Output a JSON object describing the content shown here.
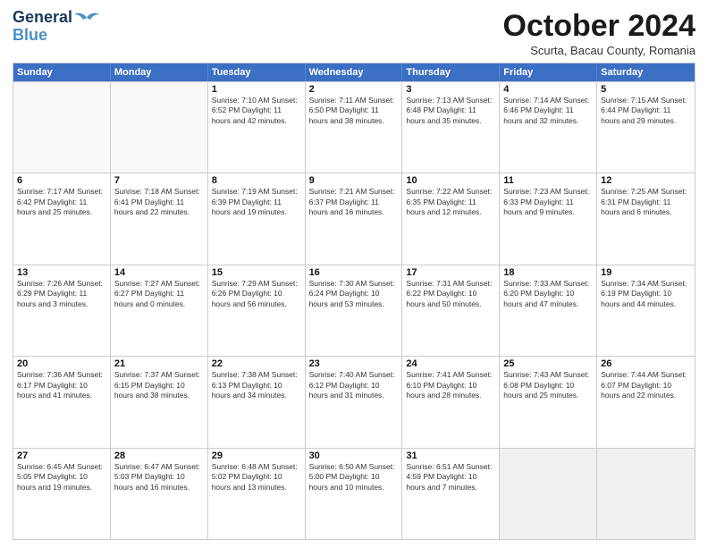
{
  "header": {
    "logo_line1": "General",
    "logo_line2": "Blue",
    "month_title": "October 2024",
    "location": "Scurta, Bacau County, Romania"
  },
  "days_of_week": [
    "Sunday",
    "Monday",
    "Tuesday",
    "Wednesday",
    "Thursday",
    "Friday",
    "Saturday"
  ],
  "weeks": [
    [
      {
        "day": "",
        "info": "",
        "empty": true
      },
      {
        "day": "",
        "info": "",
        "empty": true
      },
      {
        "day": "1",
        "info": "Sunrise: 7:10 AM\nSunset: 6:52 PM\nDaylight: 11 hours and 42 minutes."
      },
      {
        "day": "2",
        "info": "Sunrise: 7:11 AM\nSunset: 6:50 PM\nDaylight: 11 hours and 38 minutes."
      },
      {
        "day": "3",
        "info": "Sunrise: 7:13 AM\nSunset: 6:48 PM\nDaylight: 11 hours and 35 minutes."
      },
      {
        "day": "4",
        "info": "Sunrise: 7:14 AM\nSunset: 6:46 PM\nDaylight: 11 hours and 32 minutes."
      },
      {
        "day": "5",
        "info": "Sunrise: 7:15 AM\nSunset: 6:44 PM\nDaylight: 11 hours and 29 minutes."
      }
    ],
    [
      {
        "day": "6",
        "info": "Sunrise: 7:17 AM\nSunset: 6:42 PM\nDaylight: 11 hours and 25 minutes."
      },
      {
        "day": "7",
        "info": "Sunrise: 7:18 AM\nSunset: 6:41 PM\nDaylight: 11 hours and 22 minutes."
      },
      {
        "day": "8",
        "info": "Sunrise: 7:19 AM\nSunset: 6:39 PM\nDaylight: 11 hours and 19 minutes."
      },
      {
        "day": "9",
        "info": "Sunrise: 7:21 AM\nSunset: 6:37 PM\nDaylight: 11 hours and 16 minutes."
      },
      {
        "day": "10",
        "info": "Sunrise: 7:22 AM\nSunset: 6:35 PM\nDaylight: 11 hours and 12 minutes."
      },
      {
        "day": "11",
        "info": "Sunrise: 7:23 AM\nSunset: 6:33 PM\nDaylight: 11 hours and 9 minutes."
      },
      {
        "day": "12",
        "info": "Sunrise: 7:25 AM\nSunset: 6:31 PM\nDaylight: 11 hours and 6 minutes."
      }
    ],
    [
      {
        "day": "13",
        "info": "Sunrise: 7:26 AM\nSunset: 6:29 PM\nDaylight: 11 hours and 3 minutes."
      },
      {
        "day": "14",
        "info": "Sunrise: 7:27 AM\nSunset: 6:27 PM\nDaylight: 11 hours and 0 minutes."
      },
      {
        "day": "15",
        "info": "Sunrise: 7:29 AM\nSunset: 6:26 PM\nDaylight: 10 hours and 56 minutes."
      },
      {
        "day": "16",
        "info": "Sunrise: 7:30 AM\nSunset: 6:24 PM\nDaylight: 10 hours and 53 minutes."
      },
      {
        "day": "17",
        "info": "Sunrise: 7:31 AM\nSunset: 6:22 PM\nDaylight: 10 hours and 50 minutes."
      },
      {
        "day": "18",
        "info": "Sunrise: 7:33 AM\nSunset: 6:20 PM\nDaylight: 10 hours and 47 minutes."
      },
      {
        "day": "19",
        "info": "Sunrise: 7:34 AM\nSunset: 6:19 PM\nDaylight: 10 hours and 44 minutes."
      }
    ],
    [
      {
        "day": "20",
        "info": "Sunrise: 7:36 AM\nSunset: 6:17 PM\nDaylight: 10 hours and 41 minutes."
      },
      {
        "day": "21",
        "info": "Sunrise: 7:37 AM\nSunset: 6:15 PM\nDaylight: 10 hours and 38 minutes."
      },
      {
        "day": "22",
        "info": "Sunrise: 7:38 AM\nSunset: 6:13 PM\nDaylight: 10 hours and 34 minutes."
      },
      {
        "day": "23",
        "info": "Sunrise: 7:40 AM\nSunset: 6:12 PM\nDaylight: 10 hours and 31 minutes."
      },
      {
        "day": "24",
        "info": "Sunrise: 7:41 AM\nSunset: 6:10 PM\nDaylight: 10 hours and 28 minutes."
      },
      {
        "day": "25",
        "info": "Sunrise: 7:43 AM\nSunset: 6:08 PM\nDaylight: 10 hours and 25 minutes."
      },
      {
        "day": "26",
        "info": "Sunrise: 7:44 AM\nSunset: 6:07 PM\nDaylight: 10 hours and 22 minutes."
      }
    ],
    [
      {
        "day": "27",
        "info": "Sunrise: 6:45 AM\nSunset: 5:05 PM\nDaylight: 10 hours and 19 minutes."
      },
      {
        "day": "28",
        "info": "Sunrise: 6:47 AM\nSunset: 5:03 PM\nDaylight: 10 hours and 16 minutes."
      },
      {
        "day": "29",
        "info": "Sunrise: 6:48 AM\nSunset: 5:02 PM\nDaylight: 10 hours and 13 minutes."
      },
      {
        "day": "30",
        "info": "Sunrise: 6:50 AM\nSunset: 5:00 PM\nDaylight: 10 hours and 10 minutes."
      },
      {
        "day": "31",
        "info": "Sunrise: 6:51 AM\nSunset: 4:59 PM\nDaylight: 10 hours and 7 minutes."
      },
      {
        "day": "",
        "info": "",
        "empty": true
      },
      {
        "day": "",
        "info": "",
        "empty": true
      }
    ]
  ]
}
